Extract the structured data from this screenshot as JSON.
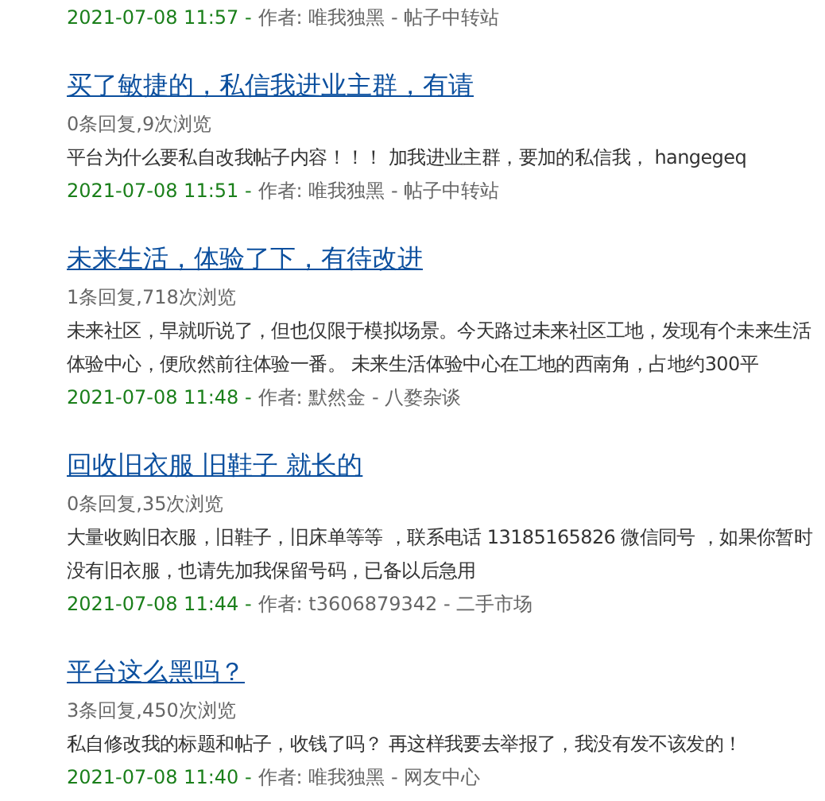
{
  "posts": [
    {
      "date": "2021-07-08 11:57 -",
      "byline": "作者: 唯我独黑 - 帖子中转站"
    },
    {
      "title": "买了敏捷的，私信我进业主群，有请",
      "stats": "0条回复,9次浏览",
      "excerpt": "平台为什么要私自改我帖子内容！！！ 加我进业主群，要加的私信我， hangegeq",
      "date": "2021-07-08 11:51 -",
      "byline": "作者: 唯我独黑 - 帖子中转站"
    },
    {
      "title": "未来生活，体验了下，有待改进",
      "stats": "1条回复,718次浏览",
      "excerpt": "未来社区，早就听说了，但也仅限于模拟场景。今天路过未来社区工地，发现有个未来生活体验中心，便欣然前往体验一番。 未来生活体验中心在工地的西南角，占地约300平",
      "date": "2021-07-08 11:48 -",
      "byline": "作者: 默然金 - 八婺杂谈"
    },
    {
      "title": "回收旧衣服 旧鞋子 就长的",
      "stats": "0条回复,35次浏览",
      "excerpt": "大量收购旧衣服，旧鞋子，旧床单等等 ，联系电话 13185165826  微信同号 ，如果你暂时没有旧衣服，也请先加我保留号码，已备以后急用",
      "date": "2021-07-08 11:44 -",
      "byline": "作者: t3606879342 - 二手市场"
    },
    {
      "title": "平台这么黑吗？",
      "stats": "3条回复,450次浏览",
      "excerpt": "私自修改我的标题和帖子，收钱了吗？ 再这样我要去举报了，我没有发不该发的！",
      "date": "2021-07-08 11:40 -",
      "byline": "作者: 唯我独黑 - 网友中心"
    }
  ]
}
